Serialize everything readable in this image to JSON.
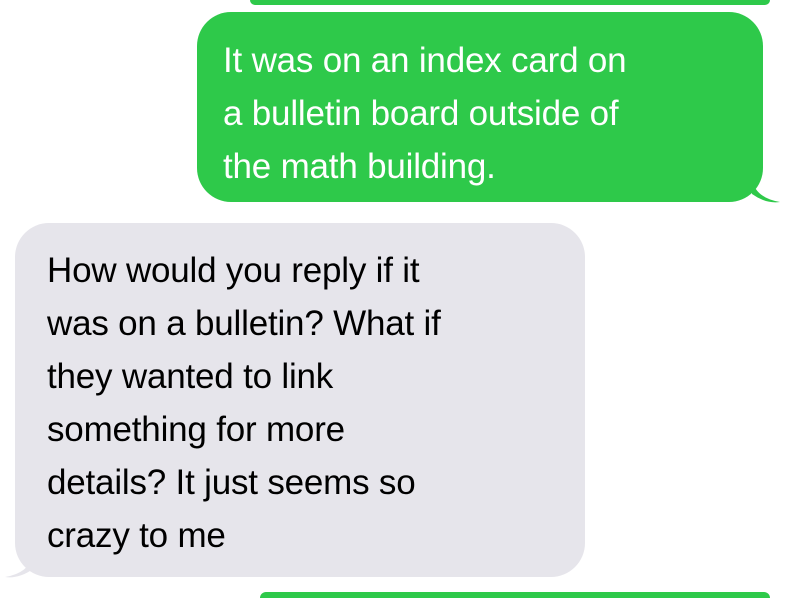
{
  "colors": {
    "sent_bubble": "#2ec94a",
    "received_bubble": "#e6e5eb",
    "background": "#ffffff"
  },
  "messages": [
    {
      "direction": "sent",
      "lines": [
        "It was on an index card on",
        "a bulletin board outside of",
        "the math building."
      ]
    },
    {
      "direction": "received",
      "lines": [
        "How would you reply if it",
        "was on a bulletin? What if",
        "they wanted to link",
        "something for more",
        "details? It just seems so",
        "crazy to me"
      ]
    }
  ]
}
